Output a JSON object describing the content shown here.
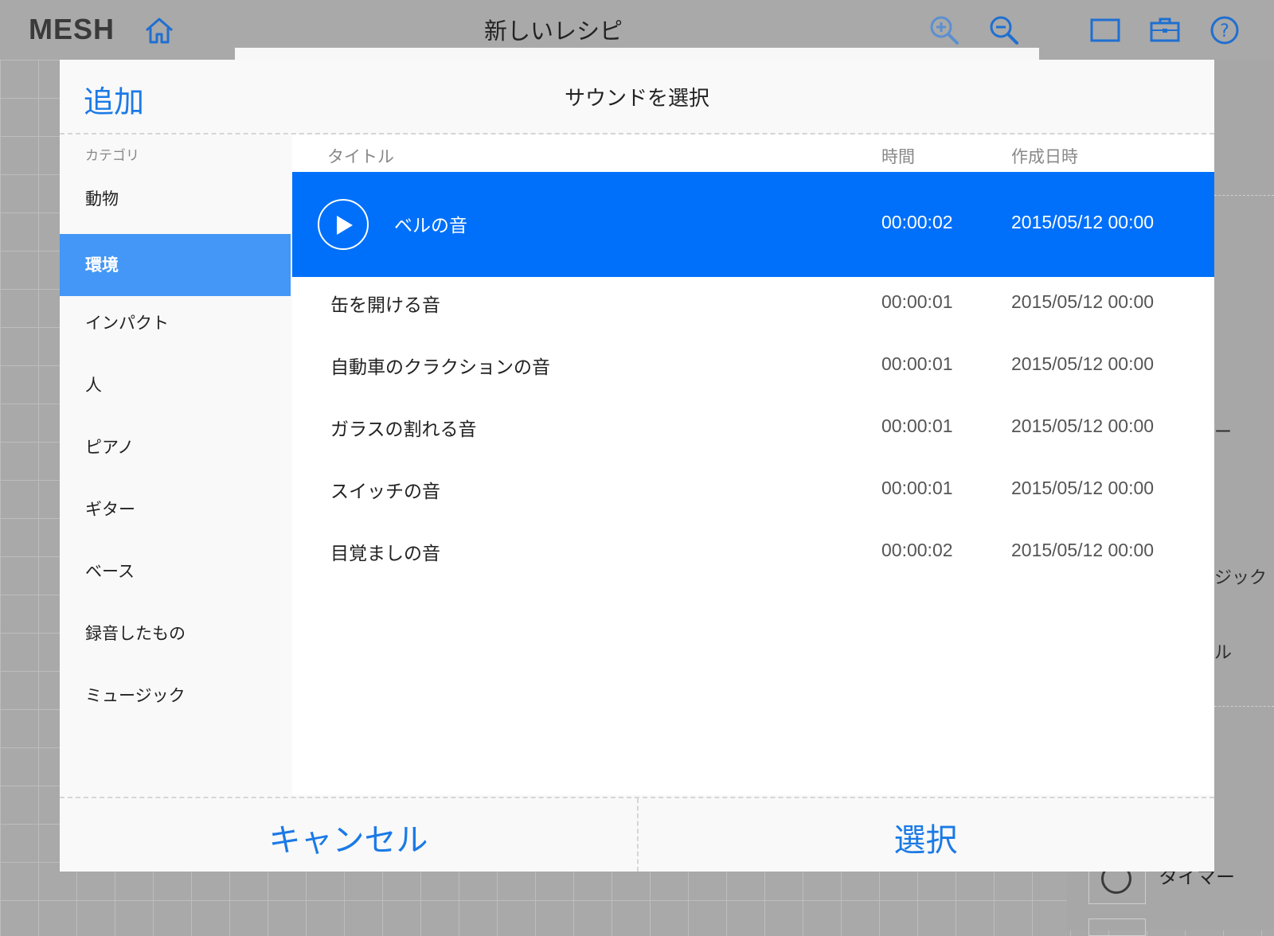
{
  "app": {
    "logo": "MESH",
    "title": "新しいレシピ"
  },
  "colors": {
    "accent": "#1b7ae6",
    "selected_row": "#0070fa",
    "active_category": "#4497f6"
  },
  "icons": [
    "home-icon",
    "zoom-in-icon",
    "zoom-out-icon",
    "window-icon",
    "toolbox-icon",
    "help-icon",
    "play-icon"
  ],
  "dialog": {
    "add_label": "追加",
    "title": "サウンドを選択",
    "category_header": "カテゴリ",
    "columns": {
      "title": "タイトル",
      "duration": "時間",
      "created": "作成日時"
    },
    "categories": [
      {
        "label": "動物",
        "active": false
      },
      {
        "label": "環境",
        "active": true
      },
      {
        "label": "インパクト",
        "active": false
      },
      {
        "label": "人",
        "active": false
      },
      {
        "label": "ピアノ",
        "active": false
      },
      {
        "label": "ギター",
        "active": false
      },
      {
        "label": "ベース",
        "active": false
      },
      {
        "label": "録音したもの",
        "active": false
      },
      {
        "label": "ミュージック",
        "active": false
      }
    ],
    "sounds": [
      {
        "title": "ベルの音",
        "duration": "00:00:02",
        "created": "2015/05/12 00:00",
        "selected": true
      },
      {
        "title": "缶を開ける音",
        "duration": "00:00:01",
        "created": "2015/05/12 00:00",
        "selected": false
      },
      {
        "title": "自動車のクラクションの音",
        "duration": "00:00:01",
        "created": "2015/05/12 00:00",
        "selected": false
      },
      {
        "title": "ガラスの割れる音",
        "duration": "00:00:01",
        "created": "2015/05/12 00:00",
        "selected": false
      },
      {
        "title": "スイッチの音",
        "duration": "00:00:01",
        "created": "2015/05/12 00:00",
        "selected": false
      },
      {
        "title": "目覚ましの音",
        "duration": "00:00:02",
        "created": "2015/05/12 00:00",
        "selected": false
      }
    ],
    "cancel_label": "キャンセル",
    "select_label": "選択"
  },
  "background": {
    "side_labels": [
      "ー",
      "ジック",
      "ル"
    ],
    "timer_label": "タイマー"
  }
}
